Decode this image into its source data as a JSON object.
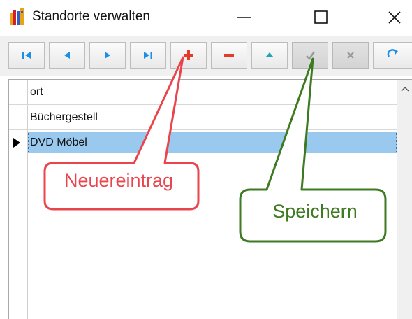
{
  "window": {
    "title": "Standorte verwalten",
    "icon": "books-icon"
  },
  "toolbar": {
    "buttons": [
      {
        "name": "first-record-button",
        "icon": "first-icon",
        "enabled": true
      },
      {
        "name": "prior-record-button",
        "icon": "prior-icon",
        "enabled": true
      },
      {
        "name": "next-record-button",
        "icon": "next-icon",
        "enabled": true
      },
      {
        "name": "last-record-button",
        "icon": "last-icon",
        "enabled": true
      },
      {
        "name": "insert-record-button",
        "icon": "plus-icon",
        "enabled": true
      },
      {
        "name": "delete-record-button",
        "icon": "minus-icon",
        "enabled": true
      },
      {
        "name": "edit-record-button",
        "icon": "edit-triangle-icon",
        "enabled": true
      },
      {
        "name": "post-record-button",
        "icon": "checkmark-icon",
        "enabled": false
      },
      {
        "name": "cancel-edit-button",
        "icon": "x-icon",
        "enabled": false
      },
      {
        "name": "refresh-button",
        "icon": "refresh-icon",
        "enabled": true
      }
    ]
  },
  "grid": {
    "column_header": "ort",
    "rows": [
      "Büchergestell",
      "DVD Möbel"
    ],
    "selected_row": 1
  },
  "callouts": {
    "new_entry": "Neuereintrag",
    "save": "Speichern"
  },
  "colors": {
    "callout_red": "#e8454c",
    "callout_green": "#3e7a22",
    "selection": "#99c9ef",
    "nav_blue": "#1b8ee6",
    "action_red": "#e33d2a"
  }
}
